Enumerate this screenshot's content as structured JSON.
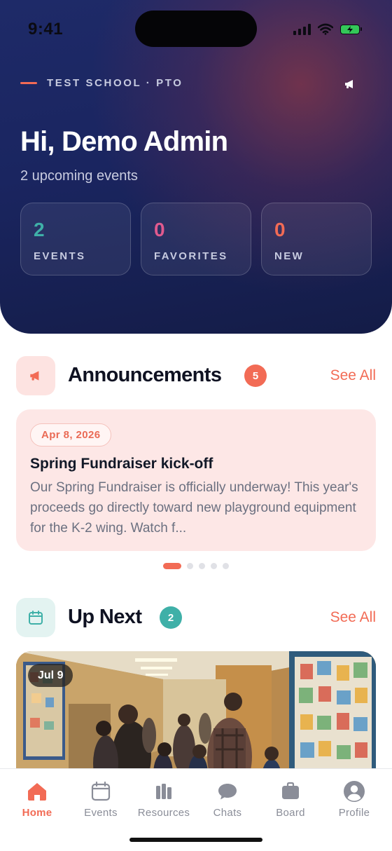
{
  "status_bar": {
    "time": "9:41"
  },
  "header": {
    "school": "TEST SCHOOL · PTO",
    "greeting": "Hi, Demo Admin",
    "subtitle": "2 upcoming events",
    "stats": [
      {
        "value": "2",
        "label": "EVENTS",
        "color": "#3fb0a8"
      },
      {
        "value": "0",
        "label": "FAVORITES",
        "color": "#e05a8e"
      },
      {
        "value": "0",
        "label": "NEW",
        "color": "#f26b55"
      }
    ]
  },
  "announcements": {
    "title": "Announcements",
    "count": "5",
    "see_all": "See All",
    "card": {
      "date": "Apr 8, 2026",
      "title": "Spring Fundraiser kick-off",
      "body": "Our Spring Fundraiser is officially underway! This year's proceeds go directly toward new playground equipment for the K-2 wing. Watch f..."
    },
    "pager": {
      "total": 5,
      "active": 1
    }
  },
  "up_next": {
    "title": "Up Next",
    "count": "2",
    "see_all": "See All",
    "event": {
      "date": "Jul 9"
    }
  },
  "tabs": [
    {
      "label": "Home",
      "icon": "home-icon",
      "active": true
    },
    {
      "label": "Events",
      "icon": "calendar-icon",
      "active": false
    },
    {
      "label": "Resources",
      "icon": "books-icon",
      "active": false
    },
    {
      "label": "Chats",
      "icon": "chat-bubble-icon",
      "active": false
    },
    {
      "label": "Board",
      "icon": "briefcase-icon",
      "active": false
    },
    {
      "label": "Profile",
      "icon": "person-circle-icon",
      "active": false
    }
  ],
  "colors": {
    "accent": "#f26b55",
    "teal": "#3fb0a8",
    "navy": "#1a2560"
  }
}
